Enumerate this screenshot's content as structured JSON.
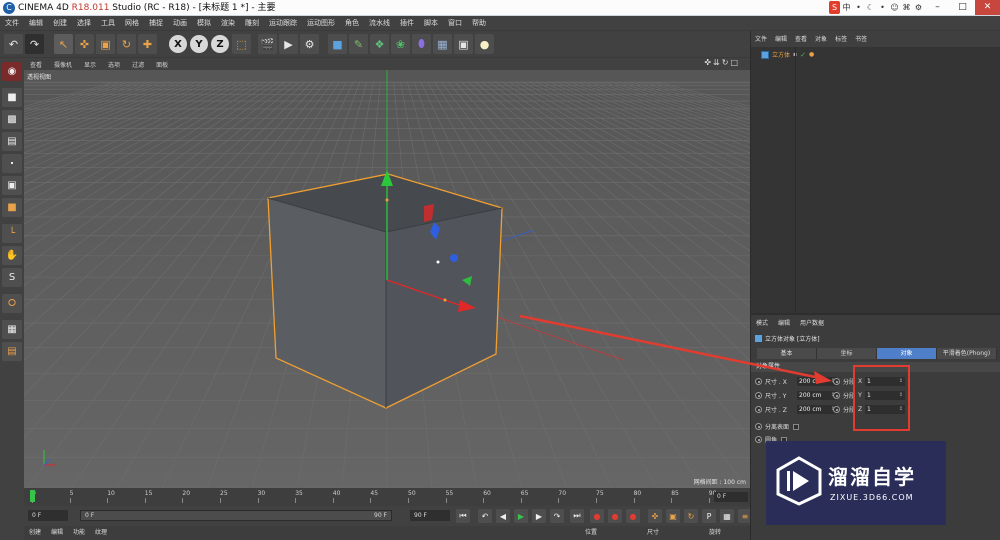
{
  "window": {
    "title_prefix": "CINEMA 4D ",
    "title_version": "R18.011",
    "title_suffix": " Studio (RC - R18) - [未标题 1 *] - 主要",
    "ime_items": [
      "中",
      "•",
      "☾",
      "•",
      "☺",
      "⌘",
      "⚙",
      "✎"
    ],
    "ime_logo": "S",
    "min": "–",
    "max": "□",
    "close": "✕"
  },
  "menubar": [
    "文件",
    "编辑",
    "创建",
    "选择",
    "工具",
    "网格",
    "捕捉",
    "动画",
    "模拟",
    "渲染",
    "雕刻",
    "运动跟踪",
    "运动图形",
    "角色",
    "流水线",
    "插件",
    "脚本",
    "窗口",
    "帮助"
  ],
  "viewport": {
    "menu": [
      "查看",
      "摄像机",
      "显示",
      "选项",
      "过滤",
      "面板"
    ],
    "nav_icons": "✜⇊↻□",
    "label": "透视视图",
    "grid_spacing": "网格间距 : 100 cm"
  },
  "timeline": {
    "ticks": [
      "0",
      "5",
      "10",
      "15",
      "20",
      "25",
      "30",
      "35",
      "40",
      "45",
      "50",
      "55",
      "60",
      "65",
      "70",
      "75",
      "80",
      "85",
      "90"
    ],
    "frame_display": "0 F"
  },
  "transport": {
    "current": "0 F",
    "range_start": "0 F",
    "range_end": "90 F",
    "end": "90 F"
  },
  "bottom": {
    "menu": [
      "创建",
      "编辑",
      "功能",
      "纹理"
    ],
    "coord_headers": [
      "位置",
      "尺寸",
      "旋转"
    ]
  },
  "object_manager": {
    "menu": [
      "文件",
      "编辑",
      "查看",
      "对象",
      "标签",
      "书签"
    ],
    "object_name": "立方体"
  },
  "attributes": {
    "menu": [
      "模式",
      "编辑",
      "用户数据"
    ],
    "title": "立方体对象 [立方体]",
    "tabs": [
      "基本",
      "坐标",
      "对象",
      "平滑着色(Phong)"
    ],
    "active_tab": "对象",
    "section": "对象属性",
    "size_rows": [
      {
        "label": "尺寸 . X",
        "value": "200 cm"
      },
      {
        "label": "尺寸 . Y",
        "value": "200 cm"
      },
      {
        "label": "尺寸 . Z",
        "value": "200 cm"
      }
    ],
    "seg_rows": [
      {
        "label": "分段",
        "axis": "X",
        "value": "1"
      },
      {
        "label": "分段",
        "axis": "Y",
        "value": "1"
      },
      {
        "label": "分段",
        "axis": "Z",
        "value": "1"
      }
    ],
    "separate_surfaces": "分离表面",
    "fillet": "圆角"
  },
  "watermark": {
    "name": "溜溜自学",
    "url": "ZIXUE.3D66.COM"
  },
  "colors": {
    "selection": "#f0a030",
    "x_axis": "#e02828",
    "y_axis": "#2cc83c",
    "z_axis": "#2f5fe0",
    "active_tab": "#4f7fc8",
    "annotation": "#e23b2f"
  }
}
